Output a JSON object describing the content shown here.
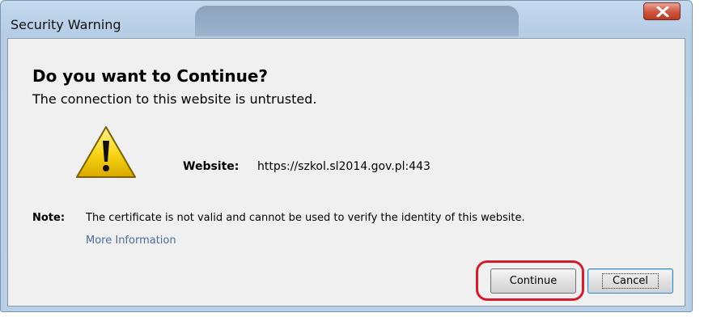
{
  "window": {
    "title": "Security Warning"
  },
  "dialog": {
    "heading": "Do you want to Continue?",
    "subheading": "The connection to this website is untrusted.",
    "website_label": "Website:",
    "website_url": "https://szkol.sl2014.gov.pl:443",
    "note_label": "Note:",
    "note_text": "The certificate is not valid and cannot be used to verify the identity of this website.",
    "more_info_link": "More Information"
  },
  "buttons": {
    "continue_label": "Continue",
    "cancel_label": "Cancel"
  },
  "icons": {
    "warning": "warning-triangle-icon",
    "close": "close-icon"
  },
  "colors": {
    "highlight": "#cf1f2e",
    "warning_yellow": "#f7d416",
    "close_red": "#c94632",
    "link": "#4a6d96"
  }
}
